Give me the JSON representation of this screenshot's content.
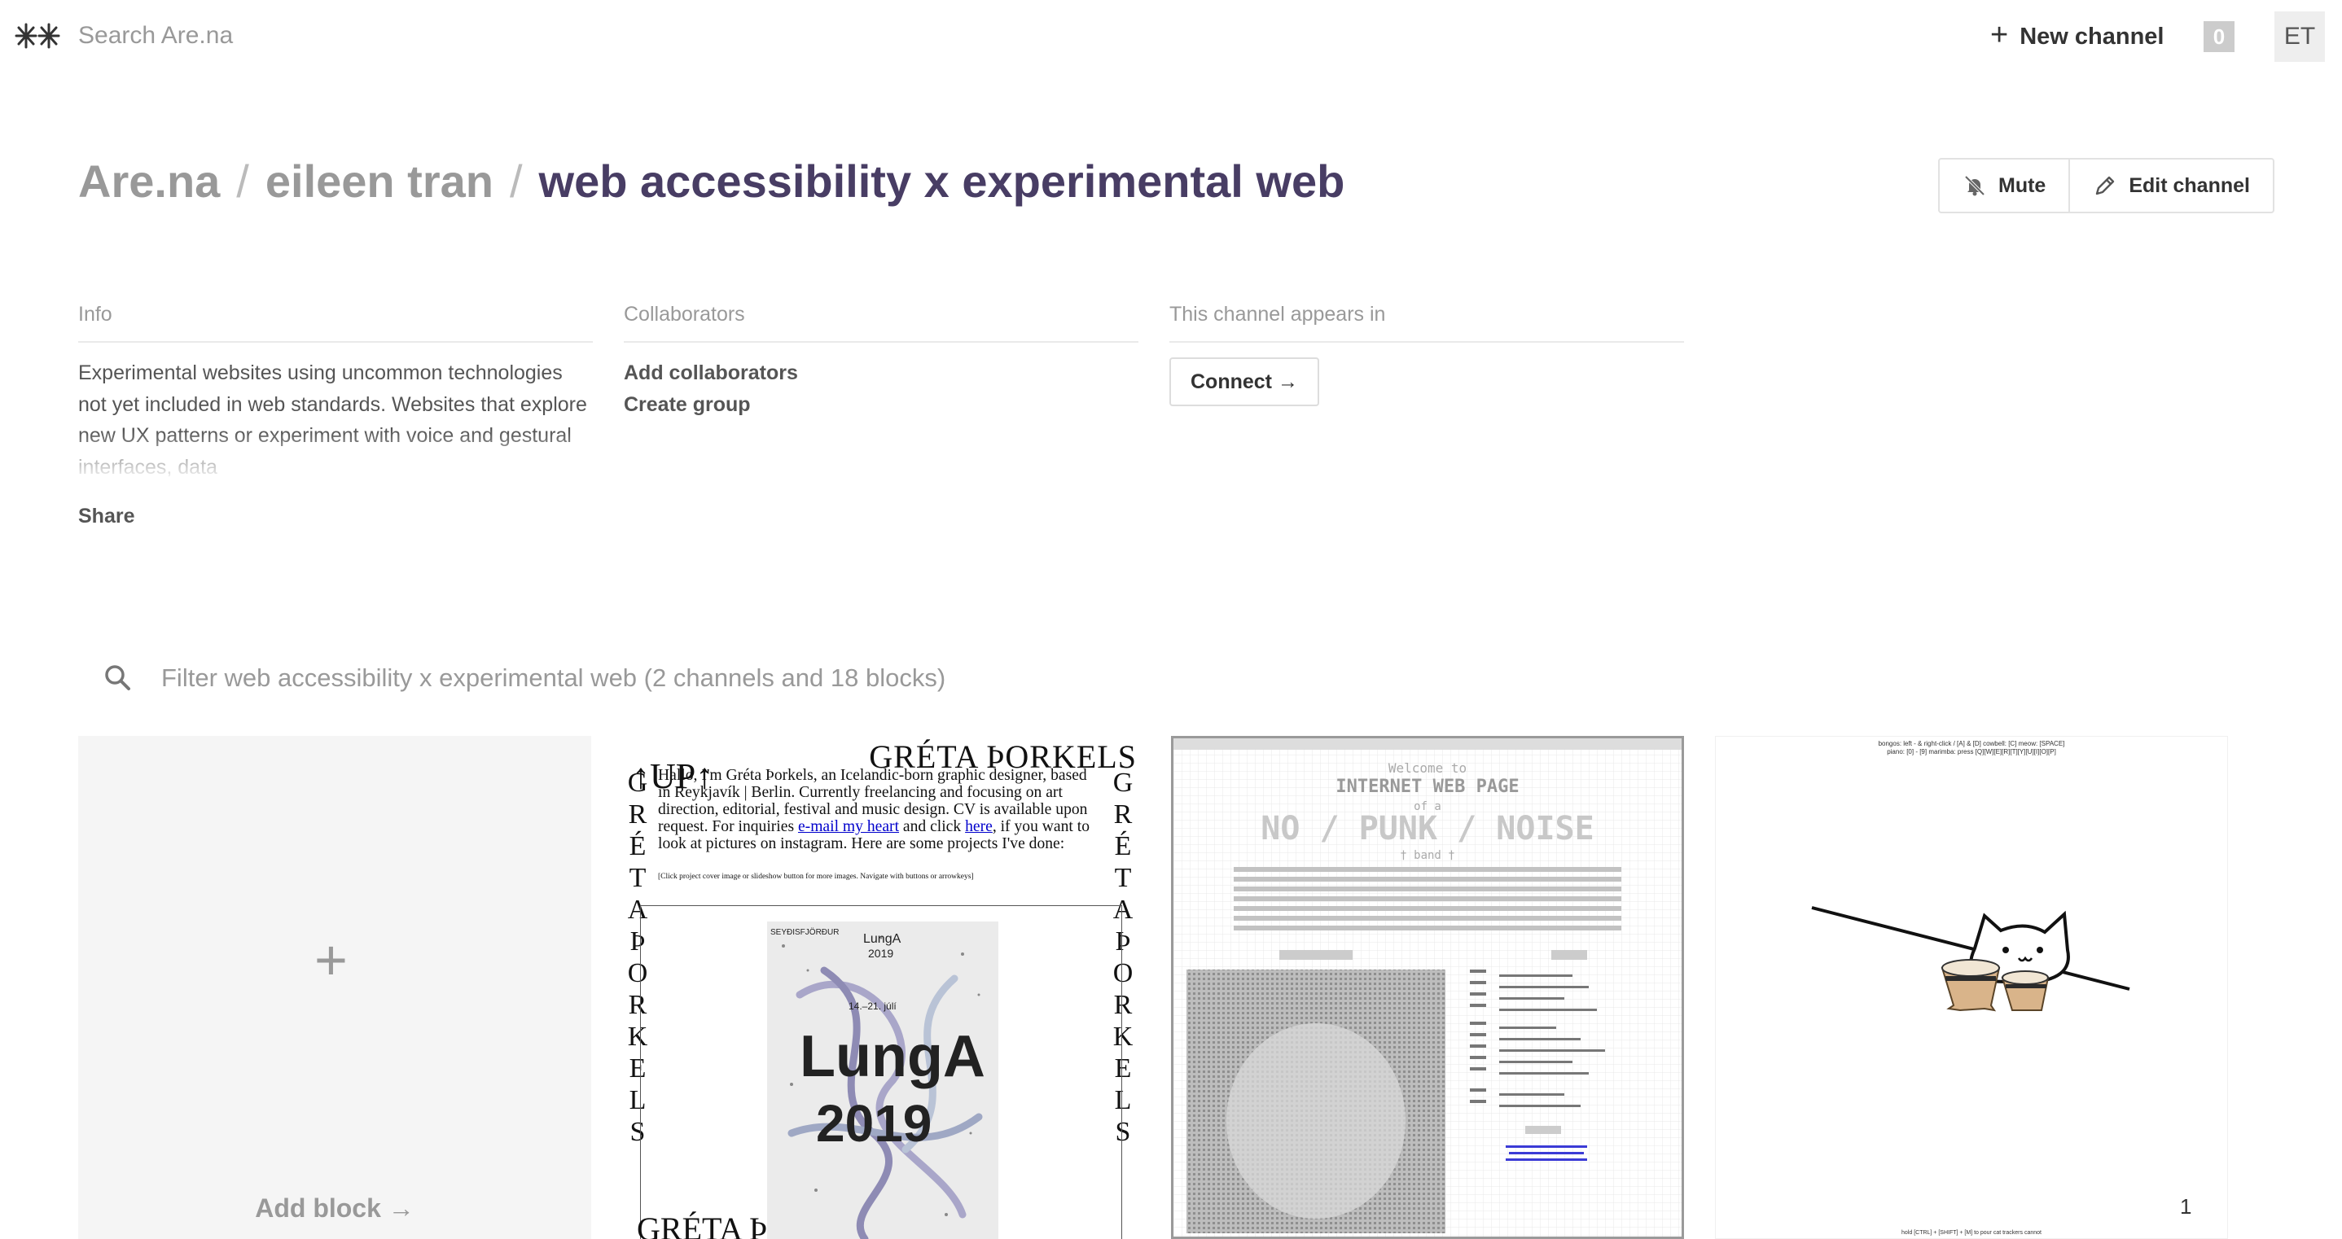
{
  "topbar": {
    "search_placeholder": "Search Are.na",
    "new_channel_label": "New channel",
    "notification_count": "0",
    "avatar_initials": "ET"
  },
  "breadcrumb": {
    "root": "Are.na",
    "user": "eileen tran",
    "channel": "web accessibility x experimental web"
  },
  "channel_actions": {
    "mute_label": "Mute",
    "edit_label": "Edit channel"
  },
  "info": {
    "heading": "Info",
    "description": "Experimental websites using uncommon technologies not yet included in web standards. Websites that explore new UX patterns or experiment with voice and gestural interfaces, data",
    "share_label": "Share"
  },
  "collaborators": {
    "heading": "Collaborators",
    "add_label": "Add collaborators",
    "group_label": "Create group"
  },
  "appears_in": {
    "heading": "This channel appears in",
    "connect_label": "Connect →"
  },
  "filter": {
    "placeholder": "Filter web accessibility x experimental web (2 channels and 18 blocks)"
  },
  "blocks": {
    "add_block_label": "Add block →",
    "greta": {
      "title": "GRÉTA ÞORKELS",
      "up": "↑UP↑",
      "vertical_left": "GRÉTA ÞORKELS",
      "vertical_right": "GRÉTA ÞORKELS",
      "intro_1": "Hallo, I'm Gréta Þorkels, an Icelandic-born graphic designer, based in Reykjavík | Berlin. Currently freelancing and focusing on art direction, editorial, festival and music design. CV is available upon request. For inquiries ",
      "email_link": "e-mail my heart",
      "intro_2": " and click ",
      "here_link": "here",
      "intro_3": ", if you want to look at pictures on instagram. Here are some projects I've done:",
      "note": "[Click project cover image or slideshow button for more images. Navigate with buttons or arrowkeys]",
      "poster_title": "LungA",
      "poster_year": "2019",
      "poster_place": "SEYÐISFJÖRÐUR",
      "poster_dates": "14.–21. júlí",
      "bottom_title": "GRÉTA Þ"
    },
    "webpage": {
      "welcome": "Welcome to",
      "title": "INTERNET WEB PAGE",
      "of_a": "of a",
      "band_big": "NO / PUNK / NOISE",
      "band": "† band †"
    },
    "bongo": {
      "header_1": "bongos: left - & right-click / [A] & [D]   cowbell: [C]   meow: [SPACE]",
      "header_2": "piano: [0] - [9]   marimba: press [Q][W][E][R][T][Y][U][I][O][P]",
      "footer": "hold [CTRL] + [SHIFT] + [M] to pour cat trackers cannot",
      "count": "1"
    }
  },
  "colors": {
    "channel_title": "#483d64",
    "muted_text": "#999999",
    "add_block_bg": "#f5f5f5"
  },
  "icons": [
    "arena-logo-icon",
    "plus-icon",
    "bell-off-icon",
    "pencil-icon",
    "search-icon"
  ]
}
